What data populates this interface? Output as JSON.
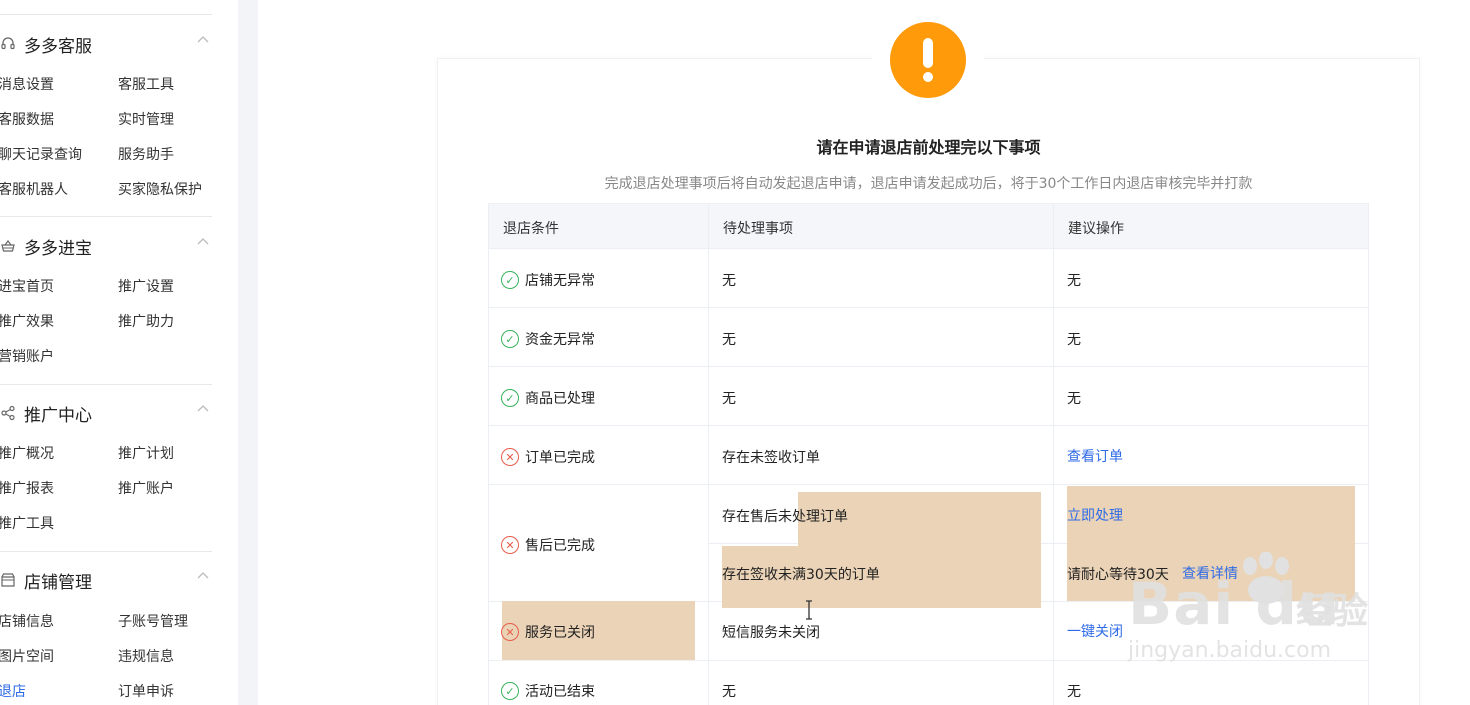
{
  "sidebar": {
    "groups": [
      {
        "title": "多多客服",
        "icon": "headset-icon",
        "items": [
          "消息设置",
          "客服工具",
          "客服数据",
          "实时管理",
          "聊天记录查询",
          "服务助手",
          "客服机器人",
          "买家隐私保护"
        ]
      },
      {
        "title": "多多进宝",
        "icon": "basket-icon",
        "items": [
          "进宝首页",
          "推广设置",
          "推广效果",
          "推广助力",
          "营销账户"
        ]
      },
      {
        "title": "推广中心",
        "icon": "share-icon",
        "items": [
          "推广概况",
          "推广计划",
          "推广报表",
          "推广账户",
          "推广工具"
        ]
      },
      {
        "title": "店铺管理",
        "icon": "store-icon",
        "items": [
          "店铺信息",
          "子账号管理",
          "图片空间",
          "违规信息",
          "退店",
          "订单申诉"
        ]
      }
    ],
    "active_item": "退店"
  },
  "main": {
    "title": "请在申请退店前处理完以下事项",
    "subtitle": "完成退店处理事项后将自动发起退店申请，退店申请发起成功后，将于30个工作日内退店审核完毕并打款",
    "table": {
      "headers": [
        "退店条件",
        "待处理事项",
        "建议操作"
      ],
      "rows": [
        {
          "status": "ok",
          "condition": "店铺无异常",
          "pending": "无",
          "action": "无"
        },
        {
          "status": "ok",
          "condition": "资金无异常",
          "pending": "无",
          "action": "无"
        },
        {
          "status": "ok",
          "condition": "商品已处理",
          "pending": "无",
          "action": "无"
        },
        {
          "status": "fail",
          "condition": "订单已完成",
          "pending": "存在未签收订单",
          "action_link": "查看订单"
        },
        {
          "status": "fail",
          "condition": "售后已完成",
          "pending": "存在售后未处理订单",
          "action_link": "立即处理"
        },
        {
          "pending": "存在签收未满30天的订单",
          "action": "请耐心等待30天",
          "action_link": "查看详情"
        },
        {
          "status": "fail",
          "condition": "服务已关闭",
          "pending": "短信服务未关闭",
          "action_link": "一键关闭"
        },
        {
          "status": "ok",
          "condition": "活动已结束",
          "pending": "无",
          "action": "无"
        }
      ]
    }
  },
  "watermark": {
    "brand": "Bai du",
    "cn": "经验",
    "url": "jingyan.baidu.com"
  },
  "colors": {
    "accent": "#2f6be6",
    "warning": "#ff9a0a",
    "ok": "#37b35a",
    "fail": "#e85d4a",
    "highlight": "#ead3b6"
  }
}
